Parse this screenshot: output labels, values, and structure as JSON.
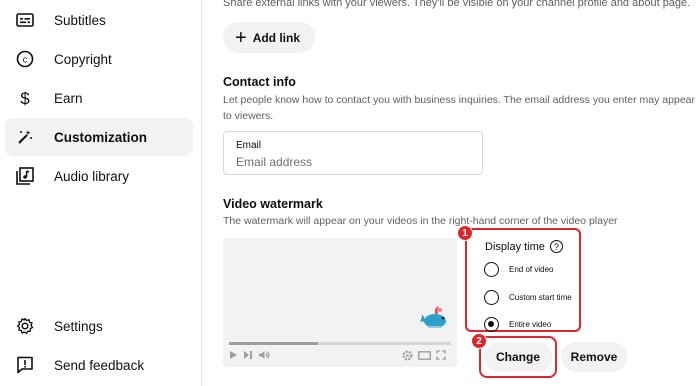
{
  "sidebar": {
    "items": [
      {
        "label": "Subtitles",
        "icon": "subtitles-icon"
      },
      {
        "label": "Copyright",
        "icon": "copyright-icon"
      },
      {
        "label": "Earn",
        "icon": "dollar-icon"
      },
      {
        "label": "Customization",
        "icon": "magic-wand-icon",
        "active": true
      },
      {
        "label": "Audio library",
        "icon": "audio-library-icon"
      },
      {
        "label": "Settings",
        "icon": "gear-icon"
      },
      {
        "label": "Send feedback",
        "icon": "feedback-icon"
      }
    ]
  },
  "links": {
    "desc": "Share external links with your viewers. They'll be visible on your channel profile and about page.",
    "add_label": "Add link"
  },
  "contact": {
    "title": "Contact info",
    "desc": "Let people know how to contact you with business inquiries. The email address you enter may appear in the About section of your channel and be visible to viewers.",
    "desc_line1": "Let people know how to contact you with business inquiries. The email address you enter may appear",
    "desc_line2": "to viewers.",
    "email_label": "Email",
    "email_placeholder": "Email address"
  },
  "watermark": {
    "title": "Video watermark",
    "desc": "The watermark will appear on your videos in the right-hand corner of the video player",
    "display_time_label": "Display time",
    "options": [
      {
        "label": "End of video",
        "checked": false
      },
      {
        "label": "Custom start time",
        "checked": false
      },
      {
        "label": "Entire video",
        "checked": true
      }
    ],
    "progress": 0.4,
    "change_label": "Change",
    "remove_label": "Remove"
  },
  "annotations": {
    "step1": "1",
    "step2": "2",
    "color": "#e0262b"
  }
}
